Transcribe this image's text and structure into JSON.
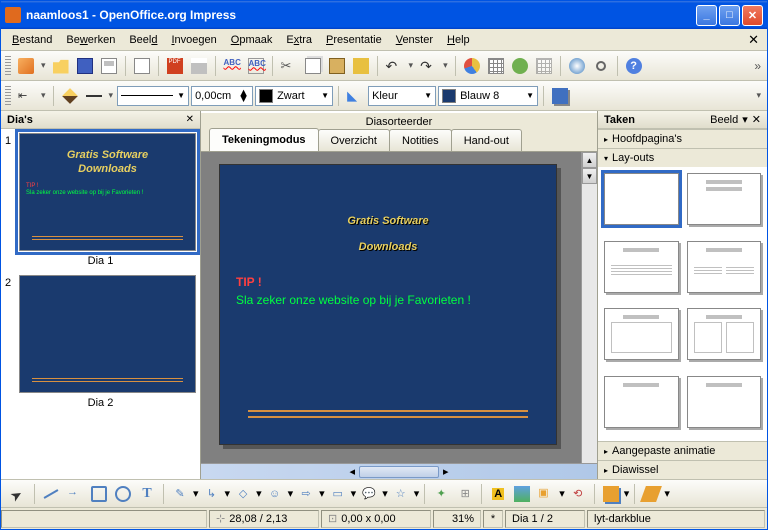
{
  "window": {
    "title": "naamloos1 - OpenOffice.org Impress"
  },
  "menu": {
    "file": "Bestand",
    "edit": "Bewerken",
    "view": "Beeld",
    "insert": "Invoegen",
    "format": "Opmaak",
    "extra": "Extra",
    "presentation": "Presentatie",
    "window": "Venster",
    "help": "Help"
  },
  "toolbar2": {
    "lineWidth": "0,00cm",
    "lineColor": "Zwart",
    "lineColorHex": "#000000",
    "fillMode": "Kleur",
    "fillColor": "Blauw 8",
    "fillColorHex": "#1a3a6e"
  },
  "slidesPanel": {
    "title": "Dia's",
    "items": [
      {
        "index": "1",
        "label": "Dia 1"
      },
      {
        "index": "2",
        "label": "Dia 2"
      }
    ]
  },
  "center": {
    "sorterLabel": "Diasorteerder",
    "tabs": {
      "drawing": "Tekeningmodus",
      "overview": "Overzicht",
      "notes": "Notities",
      "handout": "Hand-out"
    }
  },
  "slideContent": {
    "titleLine1": "Gratis Software",
    "titleLine2": "Downloads",
    "tip": "TIP !",
    "body": "Sla zeker onze website op bij je Favorieten !"
  },
  "tasks": {
    "title": "Taken",
    "viewLabel": "Beeld",
    "sections": {
      "master": "Hoofdpagina's",
      "layouts": "Lay-outs",
      "animation": "Aangepaste animatie",
      "transition": "Diawissel"
    }
  },
  "status": {
    "pos": "28,08 / 2,13",
    "size": "0,00 x 0,00",
    "zoom": "31%",
    "modified": "*",
    "slide": "Dia 1 / 2",
    "layout": "lyt-darkblue"
  }
}
